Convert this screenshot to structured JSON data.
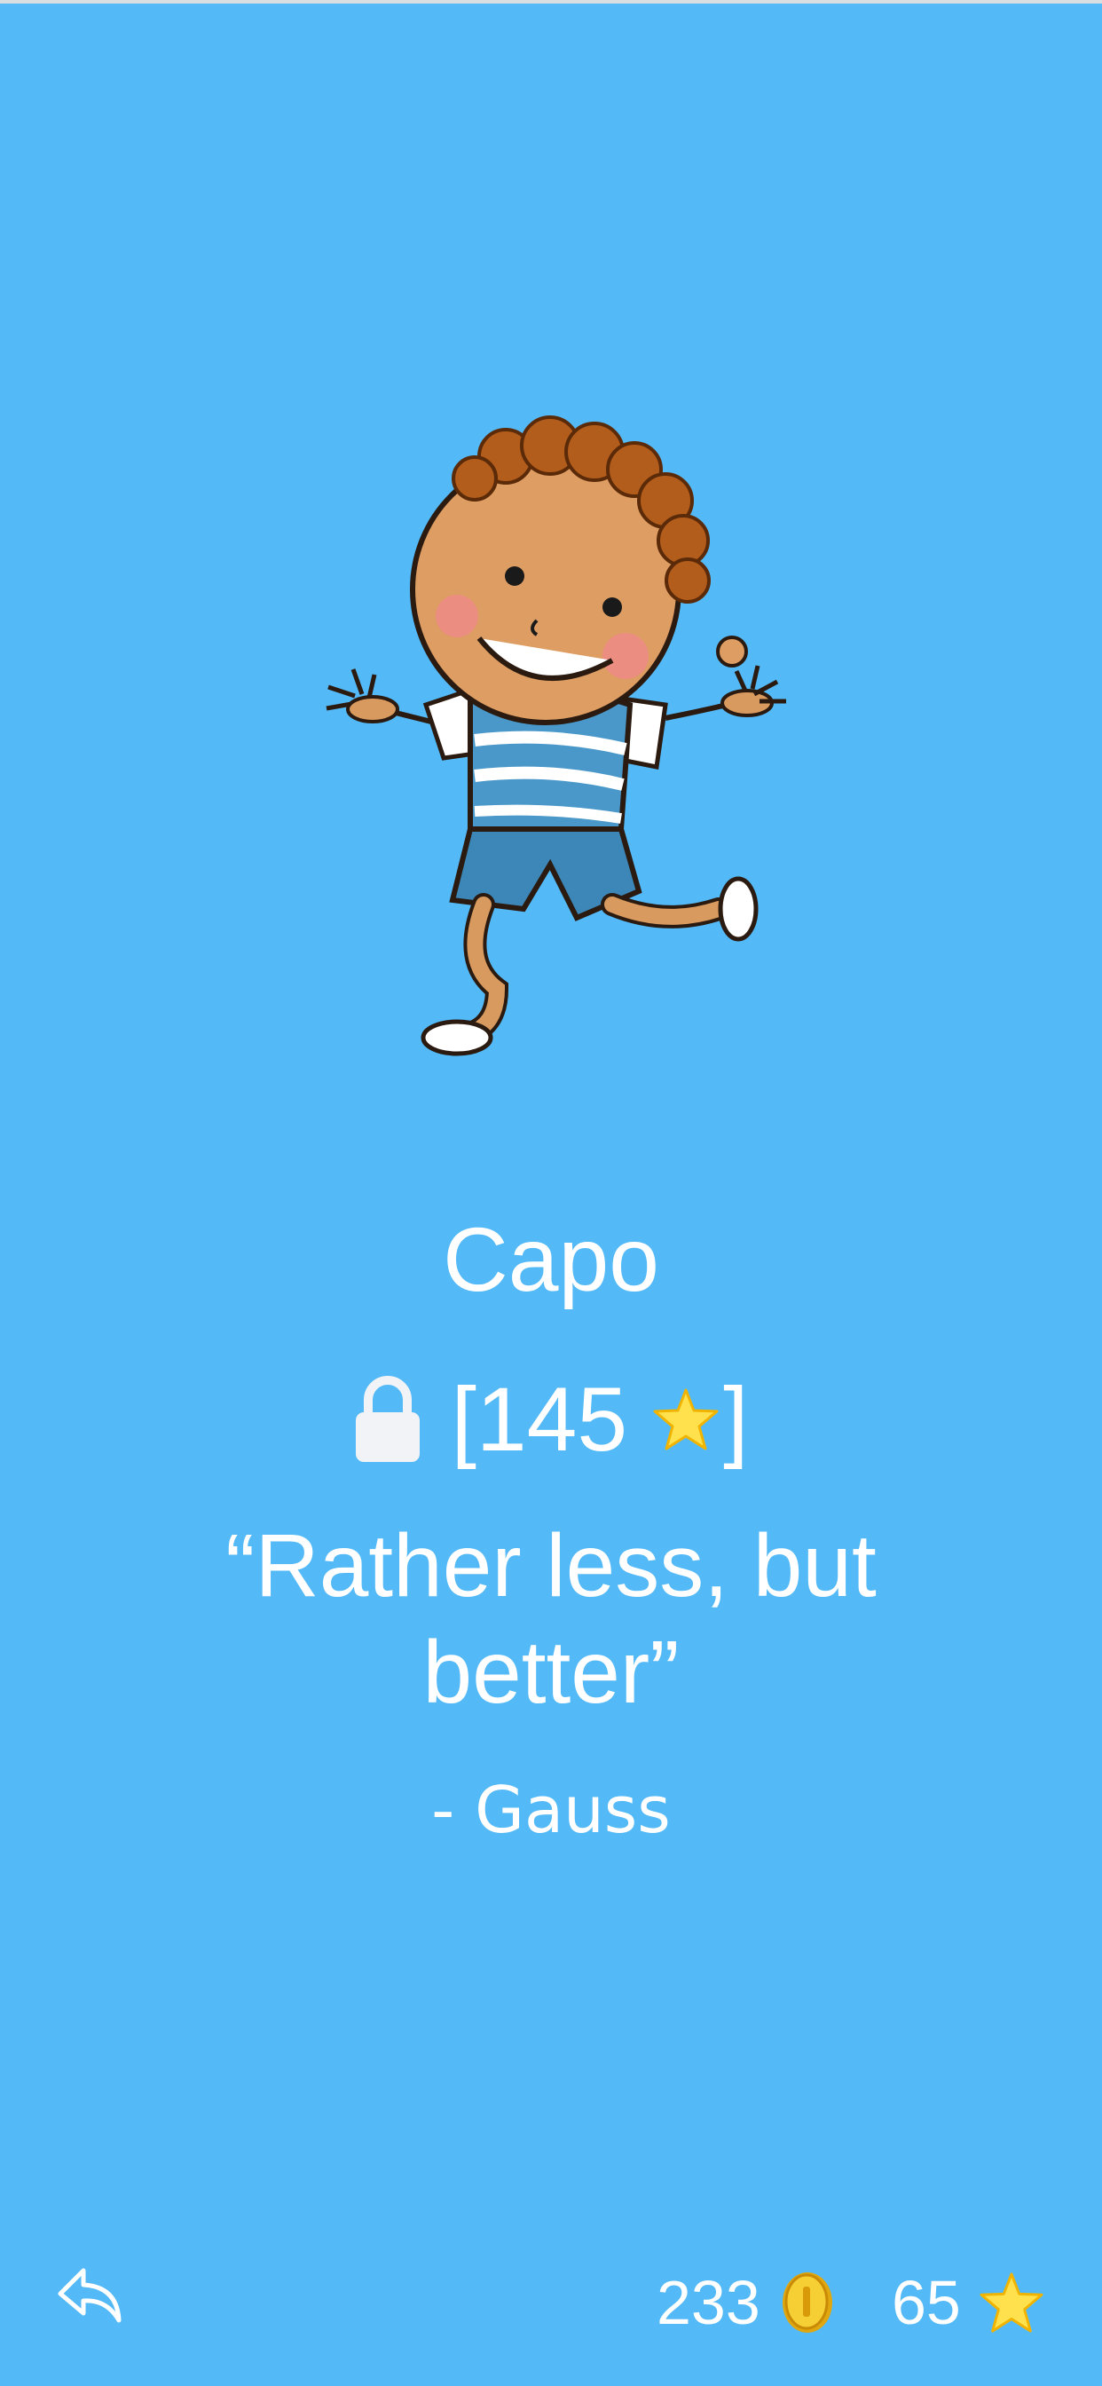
{
  "character": {
    "name": "Capo",
    "image_icon": "running-boy-illustration"
  },
  "unlock": {
    "icon": "lock-icon",
    "open_bracket": "[",
    "cost": "145",
    "cost_icon": "star-icon",
    "close_bracket": "]"
  },
  "quote": {
    "text": "“Rather less, but better”",
    "author": "- Gauss"
  },
  "footer": {
    "back_icon": "reply-arrow-icon",
    "coins": "233",
    "coin_icon": "gold-coin-icon",
    "stars": "65",
    "star_icon": "star-icon"
  },
  "colors": {
    "background": "#53b9f7",
    "text": "#ffffff",
    "star": "#ffe14d",
    "coin": "#f0c419"
  }
}
